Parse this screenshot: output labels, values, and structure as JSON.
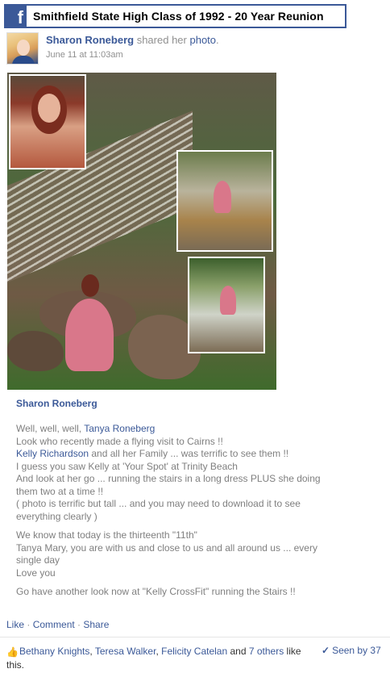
{
  "header": {
    "logo": "f",
    "group_title": "Smithfield State High Class of 1992 - 20 Year Reunion"
  },
  "post": {
    "author": "Sharon Roneberg",
    "shared_text": "shared her",
    "photo_link": "photo",
    "period": ".",
    "timestamp": "June 11 at 11:03am"
  },
  "caption": {
    "author": "Sharon Roneberg",
    "p1_l1_text": "Well, well, well, ",
    "p1_l1_mention": "Tanya Roneberg",
    "p1_l2": "Look who recently made a flying visit to Cairns !!",
    "p1_l3_mention": "Kelly Richardson",
    "p1_l3_text": " and all her Family ... was terrific to see them !!",
    "p1_l4": "I guess you saw Kelly at 'Your Spot' at Trinity Beach",
    "p1_l5": "And look at her go ... running the stairs in a long dress PLUS she doing them two at a time !!",
    "p1_l6": "( photo is terrific but tall ... and you may need to download it to see everything clearly )",
    "p2_l1": "We know that today is the thirteenth \"11th\"",
    "p2_l2": "Tanya Mary, you are with us and close to us and all around us ... every single day",
    "p2_l3": "Love you",
    "p3_l1": "Go have another look now at \"Kelly CrossFit\" running the Stairs !!"
  },
  "actions": {
    "like": "Like",
    "sep": " · ",
    "comment": "Comment",
    "share": "Share"
  },
  "likes": {
    "icon": "thumbs-up-icon",
    "name1": "Bethany Knights",
    "name2": "Teresa Walker",
    "name3": "Felicity Catelan",
    "and": " and ",
    "others": "7 others",
    "suffix": " like this."
  },
  "seen": {
    "icon": "check-icon",
    "label": "Seen by 37"
  },
  "colors": {
    "brand": "#3b5998",
    "meta_text": "#8f8f8f",
    "caption_text": "#7f7f7f"
  }
}
